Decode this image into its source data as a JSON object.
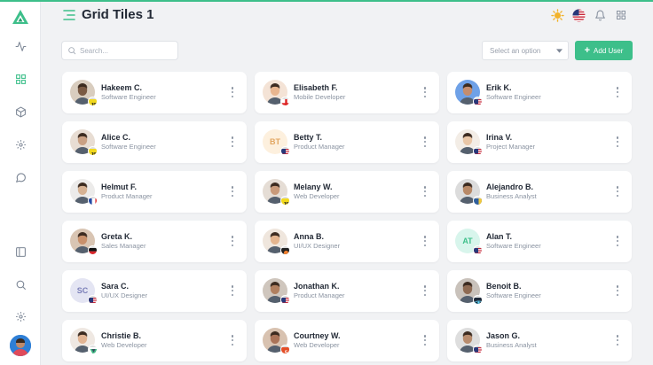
{
  "header": {
    "title": "Grid Tiles 1"
  },
  "toolbar": {
    "search_placeholder": "Search...",
    "select_placeholder": "Select an option",
    "add_button_label": "Add User"
  },
  "colors": {
    "accent": "#3dbf8a"
  },
  "sidebar": {
    "icons": [
      "logo-icon",
      "activity-icon",
      "grid-icon",
      "box-icon",
      "settings-icon",
      "chat-icon",
      "sidebar-toggle-icon",
      "search-icon",
      "settings-icon"
    ]
  },
  "users": [
    {
      "name": "Hakeem C.",
      "role": "Software Engineer",
      "avatar": "photo",
      "badge": "js-icon",
      "tone": "#7a5a44",
      "bg": "#d9cdbf"
    },
    {
      "name": "Elisabeth F.",
      "role": "Mobile Developer",
      "avatar": "photo",
      "badge": "england-flag-icon",
      "tone": "#e9b690",
      "bg": "#f4e3d6"
    },
    {
      "name": "Erik K.",
      "role": "Software Engineer",
      "avatar": "photo",
      "badge": "us-flag-icon",
      "tone": "#c58d6e",
      "bg": "#6fa1e7"
    },
    {
      "name": "Alice C.",
      "role": "Software Engineer",
      "avatar": "photo",
      "badge": "js-icon",
      "tone": "#caa184",
      "bg": "#e8ddd3"
    },
    {
      "name": "Betty T.",
      "role": "Product Manager",
      "avatar": "initials",
      "initials": "BT",
      "badge": "us-flag-icon",
      "bg": "#fdf0de",
      "fg": "#e2a662"
    },
    {
      "name": "Irina V.",
      "role": "Project Manager",
      "avatar": "photo",
      "badge": "us-flag-icon",
      "tone": "#eac7a7",
      "bg": "#f3ede6"
    },
    {
      "name": "Helmut F.",
      "role": "Product Manager",
      "avatar": "photo",
      "badge": "france-flag-icon",
      "tone": "#d6b294",
      "bg": "#ecebea"
    },
    {
      "name": "Melany W.",
      "role": "Web Developer",
      "avatar": "photo",
      "badge": "js-icon",
      "tone": "#c99a7a",
      "bg": "#e5ddd5"
    },
    {
      "name": "Alejandro B.",
      "role": "Business Analyst",
      "avatar": "photo",
      "badge": "python-icon",
      "tone": "#b88967",
      "bg": "#dcdcdc"
    },
    {
      "name": "Greta K.",
      "role": "Sales Manager",
      "avatar": "photo",
      "badge": "germany-flag-icon",
      "tone": "#c8906b",
      "bg": "#d9c5b3"
    },
    {
      "name": "Anna B.",
      "role": "UI/UX Designer",
      "avatar": "photo",
      "badge": "figma-icon",
      "tone": "#e4b58f",
      "bg": "#efe6dd"
    },
    {
      "name": "Alan T.",
      "role": "Software Engineer",
      "avatar": "initials",
      "initials": "AT",
      "badge": "us-flag-icon",
      "bg": "#d8f5ec",
      "fg": "#3dbf8a"
    },
    {
      "name": "Sara C.",
      "role": "UI/UX Designer",
      "avatar": "initials",
      "initials": "SC",
      "badge": "us-flag-icon",
      "bg": "#e4e5f3",
      "fg": "#7b7fb8"
    },
    {
      "name": "Jonathan K.",
      "role": "Product Manager",
      "avatar": "photo",
      "badge": "us-flag-icon",
      "tone": "#b07f5f",
      "bg": "#cfc6bd"
    },
    {
      "name": "Benoit B.",
      "role": "Software Engineer",
      "avatar": "photo",
      "badge": "react-icon",
      "tone": "#8e6a52",
      "bg": "#c9c2bb"
    },
    {
      "name": "Christie B.",
      "role": "Web Developer",
      "avatar": "photo",
      "badge": "vue-icon",
      "tone": "#e1b493",
      "bg": "#efe8e2"
    },
    {
      "name": "Courtney W.",
      "role": "Web Developer",
      "avatar": "photo",
      "badge": "html5-icon",
      "tone": "#a97358",
      "bg": "#d8c2b0"
    },
    {
      "name": "Jason G.",
      "role": "Business Analyst",
      "avatar": "photo",
      "badge": "us-flag-icon",
      "tone": "#b78b6d",
      "bg": "#dedede"
    }
  ]
}
